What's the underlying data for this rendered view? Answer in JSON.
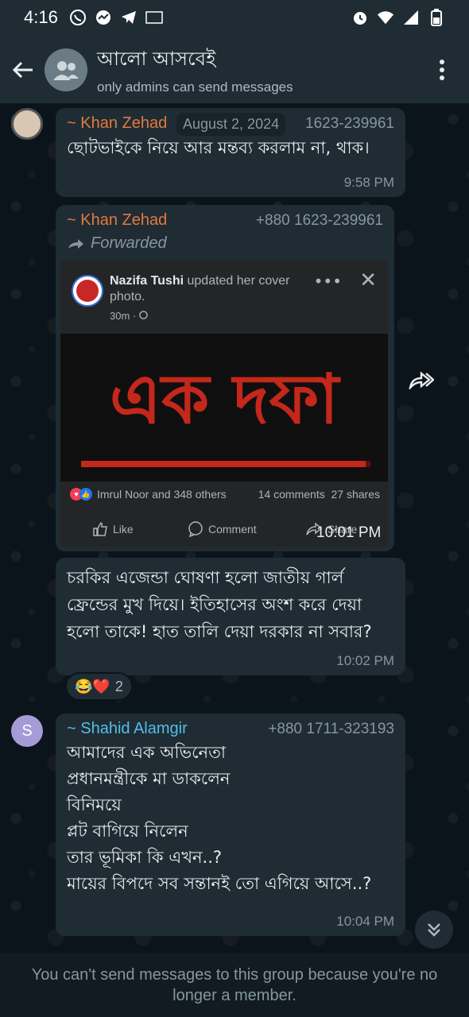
{
  "status_bar": {
    "time": "4:16",
    "icons_left": [
      "whatsapp-icon",
      "messenger-icon",
      "telegram-icon",
      "gmail-icon"
    ],
    "icons_right": [
      "alarm-icon",
      "wifi-icon",
      "signal-icon",
      "battery-icon"
    ]
  },
  "header": {
    "group_name": "আলো আসবেই",
    "subtitle": "only admins can send messages"
  },
  "messages": [
    {
      "sender": "~ Khan Zehad",
      "phone": "1623-239961",
      "text": "ছোটভাইকে নিয়ে আর মন্তব্য করলাম না, থাক।",
      "time": "9:58 PM"
    },
    {
      "sender": "~ Khan Zehad",
      "phone": "+880 1623-239961",
      "forwarded_label": "Forwarded",
      "time": "10:01 PM",
      "fb_post": {
        "author": "Nazifa Tushi",
        "action": " updated her cover photo.",
        "time": "30m · ",
        "reactions_text": "Imrul Noor and 348 others",
        "comments": "14 comments",
        "shares": "27 shares",
        "like_label": "Like",
        "comment_label": "Comment",
        "share_label": "Share",
        "image_text": "এক দফা"
      }
    },
    {
      "text": "চরকির এজেন্ডা ঘোষণা হলো জাতীয় গার্ল ফ্রেন্ডের মুখ দিয়ে। ইতিহাসের অংশ করে দেয়া হলো তাকে! হাত তালি দেয়া দরকার না সবার?",
      "time": "10:02 PM",
      "reactions": {
        "emojis": "😂❤️",
        "count": "2"
      }
    },
    {
      "sender": "~ Shahid Alamgir",
      "avatar_letter": "S",
      "phone": "+880 1711-323193",
      "lines": [
        "আমাদের এক অভিনেতা",
        "প্রধানমন্ত্রীকে মা ডাকলেন",
        "বিনিময়ে",
        "প্লট বাগিয়ে নিলেন",
        "তার ভূমিকা কি এখন..?",
        "মায়ের বিপদে সব সন্তানই তো এগিয়ে আসে..?"
      ],
      "time": "10:04 PM"
    }
  ],
  "date_chip": "August 2, 2024",
  "footer_text": "You can't send messages to this group because you're no longer a member.",
  "colors": {
    "header_bg": "#1f2c34",
    "chat_bg": "#0b141a",
    "bubble_bg": "#202c33",
    "sender_orange": "#e07a3f",
    "sender_blue": "#53bdeb"
  }
}
